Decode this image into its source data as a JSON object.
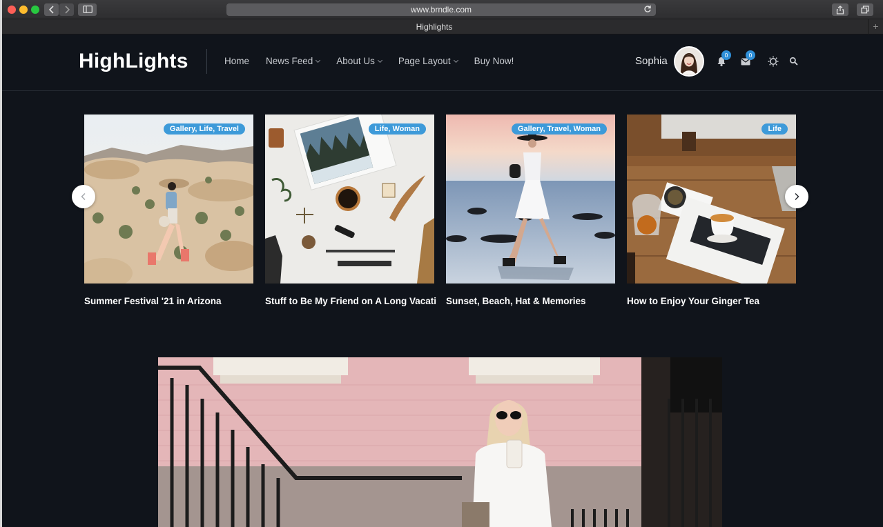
{
  "browser": {
    "url": "www.brndle.com",
    "tab_title": "Highlights"
  },
  "site": {
    "logo": "HighLights",
    "menu": [
      {
        "label": "Home",
        "has_dropdown": false
      },
      {
        "label": "News Feed",
        "has_dropdown": true
      },
      {
        "label": "About Us",
        "has_dropdown": true
      },
      {
        "label": "Page Layout",
        "has_dropdown": true
      },
      {
        "label": "Buy Now!",
        "has_dropdown": false
      }
    ],
    "user": {
      "name": "Sophia",
      "notifications_count": "0",
      "messages_count": "0"
    }
  },
  "carousel": {
    "cards": [
      {
        "tags": "Gallery, Life, Travel",
        "title": "Summer Festival '21 in Arizona",
        "image": "desert-hiker"
      },
      {
        "tags": "Life, Woman",
        "title": "Stuff to Be My Friend on A Long Vacation",
        "image": "desk-flatlay"
      },
      {
        "tags": "Gallery, Travel, Woman",
        "title": "Sunset, Beach, Hat & Memories",
        "image": "beach-walk"
      },
      {
        "tags": "Life",
        "title": "How to Enjoy Your Ginger Tea",
        "image": "tea-table"
      }
    ]
  },
  "featured": {
    "image": "woman-pink-wall"
  },
  "colors": {
    "background": "#10141b",
    "accent": "#3d9ad9",
    "text": "#ffffff"
  }
}
